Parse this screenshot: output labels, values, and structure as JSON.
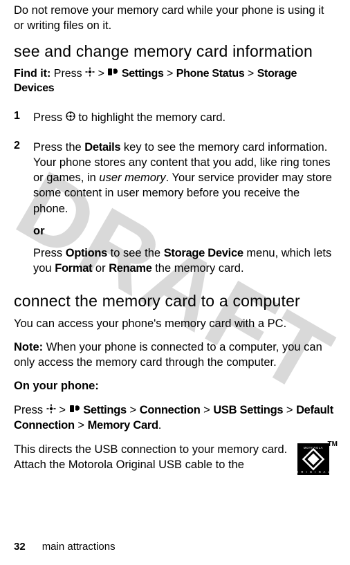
{
  "watermark": "DRAFT",
  "intro": "Do not remove your memory card while your phone is using it or writing files on it.",
  "section1": {
    "heading": "see and change memory card information",
    "findit_label": "Find it:",
    "findit_press": "Press",
    "findit_settings": "Settings",
    "findit_phonestatus": "Phone Status",
    "findit_storage": "Storage Devices",
    "gt": ">"
  },
  "steps": {
    "s1_num": "1",
    "s1_a": "Press",
    "s1_b": "to highlight the memory card.",
    "s2_num": "2",
    "s2_a": "Press the",
    "s2_details": "Details",
    "s2_b": "key to see the memory card information. Your phone stores any content that you add, like ring tones or games, in",
    "s2_usermem": "user memory",
    "s2_c": ". Your service provider may store some content in user memory before you receive the phone.",
    "or": "or",
    "s2_d": "Press",
    "s2_options": "Options",
    "s2_e": "to see the",
    "s2_sd": "Storage Device",
    "s2_f": "menu, which lets you",
    "s2_format": "Format",
    "s2_g": "or",
    "s2_rename": "Rename",
    "s2_h": "the memory card."
  },
  "section2": {
    "heading": "connect the memory card to a computer",
    "p1": "You can access your phone's memory card with a PC.",
    "note_label": "Note:",
    "note": "When your phone is connected to a computer, you can only access the memory card through the computer.",
    "onphone": "On your phone:",
    "press": "Press",
    "settings": "Settings",
    "connection": "Connection",
    "usb": "USB Settings",
    "defconn": "Default Connection",
    "memcard": "Memory Card",
    "gt": ">",
    "p2": "This directs the USB connection to your memory card. Attach the Motorola Original USB cable to the",
    "tm": "TM",
    "logo_top": "MOTOROLA",
    "logo_bottom": "O R I G I N A L"
  },
  "footer": {
    "page": "32",
    "section": "main attractions"
  }
}
